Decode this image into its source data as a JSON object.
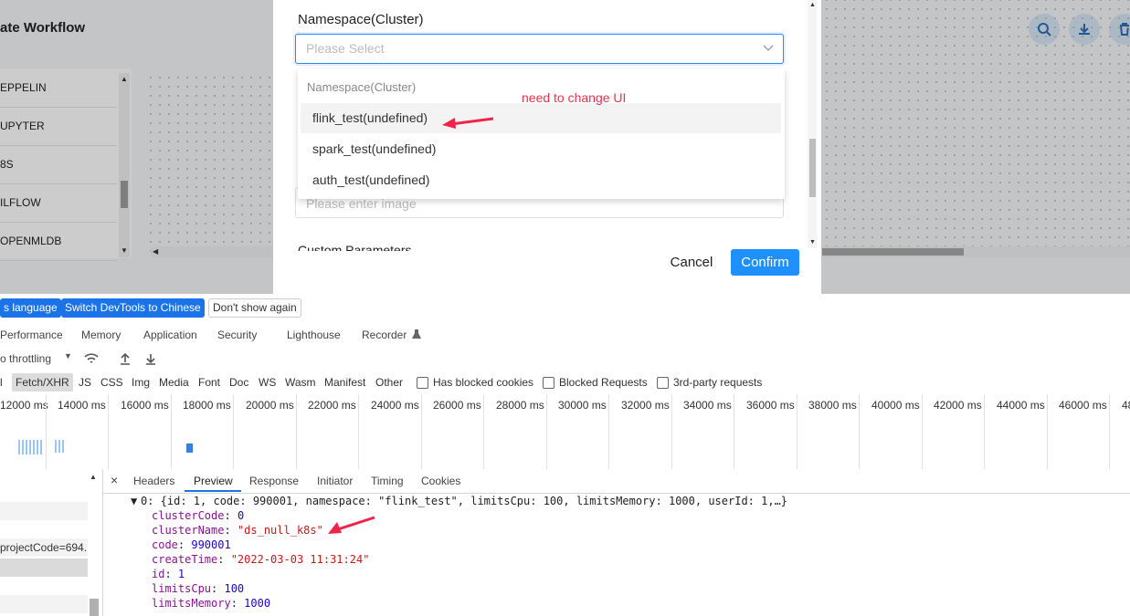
{
  "app": {
    "title": "ate Workflow",
    "task_items": [
      "EPPELIN",
      "UPYTER",
      "8S",
      "ILFLOW",
      "OPENMLDB"
    ]
  },
  "dialog": {
    "namespace_label": "Namespace(Cluster)",
    "namespace_placeholder": "Please Select",
    "image_placeholder": "Please enter image",
    "custom_params_label": "Custom Parameters",
    "cancel_label": "Cancel",
    "confirm_label": "Confirm",
    "dropdown": {
      "group_label": "Namespace(Cluster)",
      "options": [
        "flink_test(undefined)",
        "spark_test(undefined)",
        "auth_test(undefined)"
      ]
    },
    "annotation": "need to change UI"
  },
  "devtools": {
    "lang_bar": {
      "match_language": "s language",
      "switch_chinese": "Switch DevTools to Chinese",
      "dont_show": "Don't show again"
    },
    "panel_tabs": [
      "Performance",
      "Memory",
      "Application",
      "Security",
      "Lighthouse",
      "Recorder"
    ],
    "toolbar": {
      "throttling": "o throttling"
    },
    "filters": [
      "l",
      "Fetch/XHR",
      "JS",
      "CSS",
      "Img",
      "Media",
      "Font",
      "Doc",
      "WS",
      "Wasm",
      "Manifest",
      "Other"
    ],
    "checkboxes": [
      "Has blocked cookies",
      "Blocked Requests",
      "3rd-party requests"
    ],
    "timeline_ticks": [
      "12000 ms",
      "14000 ms",
      "16000 ms",
      "18000 ms",
      "20000 ms",
      "22000 ms",
      "24000 ms",
      "26000 ms",
      "28000 ms",
      "30000 ms",
      "32000 ms",
      "34000 ms",
      "36000 ms",
      "38000 ms",
      "40000 ms",
      "42000 ms",
      "44000 ms",
      "46000 ms",
      "48"
    ],
    "request_row_text": "projectCode=694...",
    "detail_tabs": [
      "Headers",
      "Preview",
      "Response",
      "Initiator",
      "Timing",
      "Cookies"
    ],
    "preview": {
      "summary": "0: {id: 1, code: 990001, namespace: \"flink_test\", limitsCpu: 100, limitsMemory: 1000, userId: 1,…}",
      "fields": [
        {
          "key": "clusterCode",
          "value": "0",
          "type": "num"
        },
        {
          "key": "clusterName",
          "value": "\"ds_null_k8s\"",
          "type": "str"
        },
        {
          "key": "code",
          "value": "990001",
          "type": "num"
        },
        {
          "key": "createTime",
          "value": "\"2022-03-03 11:31:24\"",
          "type": "str"
        },
        {
          "key": "id",
          "value": "1",
          "type": "num"
        },
        {
          "key": "limitsCpu",
          "value": "100",
          "type": "num"
        },
        {
          "key": "limitsMemory",
          "value": "1000",
          "type": "num"
        }
      ]
    }
  },
  "colors": {
    "accent": "#1e90ff",
    "annotation": "#e8344e",
    "devtools_blue": "#1a73e8"
  }
}
